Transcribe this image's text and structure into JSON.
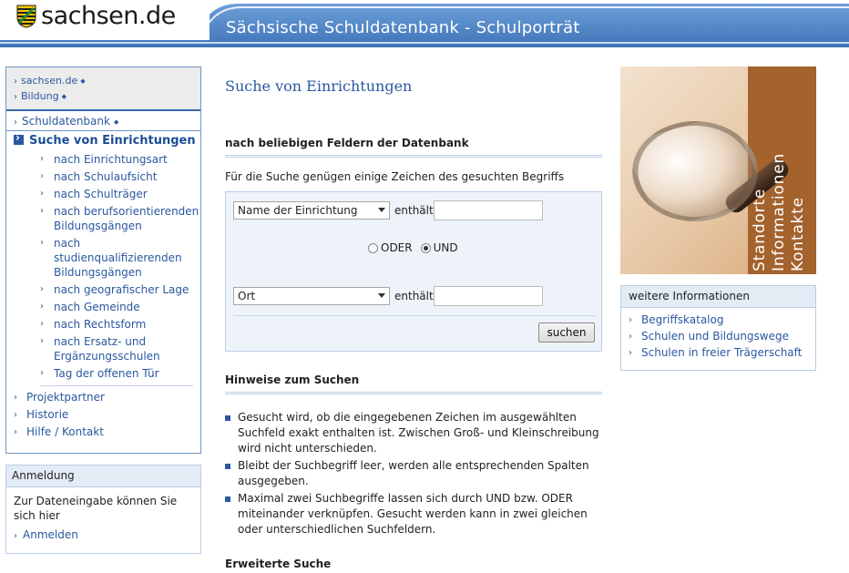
{
  "header": {
    "logo_text": "sachsen.de",
    "title": "Sächsische Schuldatenbank - Schulporträt"
  },
  "leftnav": {
    "top_items": [
      "sachsen.de",
      "Bildung"
    ],
    "section": "Schuldatenbank",
    "active": "Suche von Einrichtungen",
    "sub_items": [
      "nach Einrichtungsart",
      "nach Schulaufsicht",
      "nach Schulträger",
      "nach berufsorientierenden Bildungsgängen",
      "nach studienqualifizierenden Bildungsgängen",
      "nach geografischer Lage",
      "nach Gemeinde",
      "nach Rechtsform",
      "nach Ersatz- und Ergänzungsschulen",
      "Tag der offenen Tür"
    ],
    "bottom_items": [
      "Projektpartner",
      "Historie",
      "Hilfe / Kontakt"
    ]
  },
  "login": {
    "title": "Anmeldung",
    "text": "Zur Dateneingabe können Sie sich hier",
    "link": "Anmelden"
  },
  "main": {
    "page_title": "Suche von Einrichtungen",
    "section1": "nach beliebigen Feldern der Datenbank",
    "hint": "Für die Suche genügen einige Zeichen des gesuchten Begriffs",
    "field1": {
      "selected": "Name der Einrichtung",
      "label": "enthält",
      "value": ""
    },
    "field2": {
      "selected": "Ort",
      "label": "enthält",
      "value": ""
    },
    "radio": {
      "or_label": "ODER",
      "and_label": "UND",
      "selected": "UND"
    },
    "search_button": "suchen",
    "section2": "Hinweise zum Suchen",
    "bullets": [
      "Gesucht wird, ob die eingegebenen Zeichen im ausgewählten Suchfeld exakt enthalten ist. Zwischen Groß- und Kleinschreibung wird nicht unterschieden.",
      "Bleibt der Suchbegriff leer, werden alle entsprechenden Spalten ausgegeben.",
      "Maximal zwei Suchbegriffe lassen sich durch UND bzw. ODER miteinander verknüpfen. Gesucht werden kann in zwei gleichen oder unterschiedlichen Suchfeldern."
    ],
    "section3": "Erweiterte Suche"
  },
  "promo": {
    "lines": [
      "Standorte",
      "Informationen",
      "Kontakte"
    ]
  },
  "info": {
    "title": "weitere Informationen",
    "links": [
      "Begriffskatalog",
      "Schulen und Bildungswege",
      "Schulen in freier Trägerschaft"
    ]
  },
  "colors": {
    "header_blue": "#4a7fc1",
    "link_blue": "#2a58a0",
    "promo_brown": "#a4622d"
  }
}
